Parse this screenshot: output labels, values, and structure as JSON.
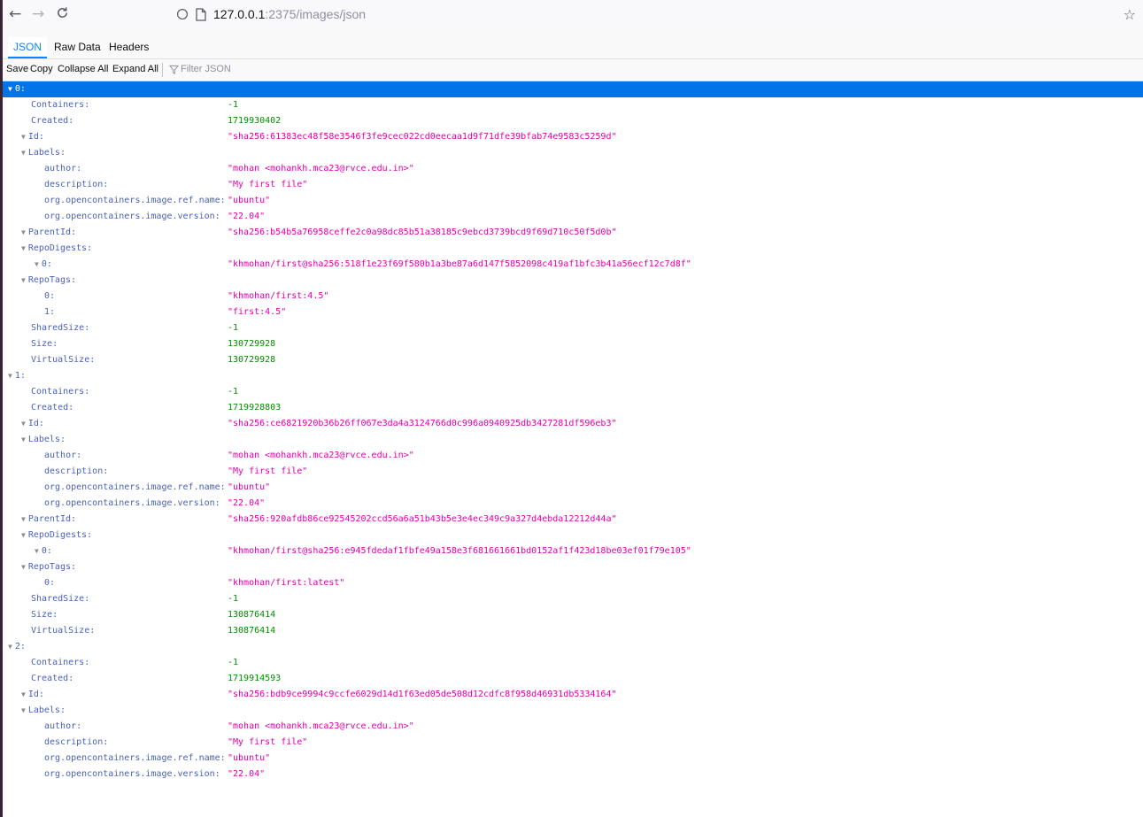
{
  "browser": {
    "back_icon": "arrow-left-icon",
    "forward_icon": "arrow-right-icon",
    "reload_icon": "reload-icon",
    "url_host": "127.0.0.1",
    "url_rest": ":2375/images/json",
    "bookmark_icon": "star-icon"
  },
  "tabs": [
    "JSON",
    "Raw Data",
    "Headers"
  ],
  "toolbar": {
    "save": "Save",
    "copy": "Copy",
    "collapse_all": "Collapse All",
    "expand_all": "Expand All",
    "filter_placeholder": "Filter JSON"
  },
  "colors": {
    "accent": "#0a84ff",
    "selected_row": "#0074e8",
    "key": "#4a62b8",
    "number": "#058b00",
    "string": "#dd00a9"
  },
  "json_rows": [
    {
      "depth": 0,
      "twisty": true,
      "key": "0:",
      "value": "",
      "type": "",
      "selected": true
    },
    {
      "depth": 1,
      "twisty": false,
      "key": "Containers:",
      "value": "-1",
      "type": "num"
    },
    {
      "depth": 1,
      "twisty": false,
      "key": "Created:",
      "value": "1719930402",
      "type": "num"
    },
    {
      "depth": 1,
      "twisty": true,
      "key": "Id:",
      "value": "\"sha256:61383ec48f58e3546f3fe9cec022cd0eecaa1d9f71dfe39bfab74e9583c5259d\"",
      "type": "str"
    },
    {
      "depth": 1,
      "twisty": true,
      "key": "Labels:",
      "value": "",
      "type": ""
    },
    {
      "depth": 2,
      "twisty": false,
      "key": "author:",
      "value": "\"mohan <mohankh.mca23@rvce.edu.in>\"",
      "type": "str"
    },
    {
      "depth": 2,
      "twisty": false,
      "key": "description:",
      "value": "\"My first file\"",
      "type": "str"
    },
    {
      "depth": 2,
      "twisty": false,
      "key": "org.opencontainers.image.ref.name:",
      "value": "\"ubuntu\"",
      "type": "str"
    },
    {
      "depth": 2,
      "twisty": false,
      "key": "org.opencontainers.image.version:",
      "value": "\"22.04\"",
      "type": "str"
    },
    {
      "depth": 1,
      "twisty": true,
      "key": "ParentId:",
      "value": "\"sha256:b54b5a76958ceffe2c0a98dc85b51a38185c9ebcd3739bcd9f69d710c50f5d0b\"",
      "type": "str"
    },
    {
      "depth": 1,
      "twisty": true,
      "key": "RepoDigests:",
      "value": "",
      "type": ""
    },
    {
      "depth": 2,
      "twisty": true,
      "key": "0:",
      "value": "\"khmohan/first@sha256:518f1e23f69f580b1a3be87a6d147f5852098c419af1bfc3b41a56ecf12c7d8f\"",
      "type": "str"
    },
    {
      "depth": 1,
      "twisty": true,
      "key": "RepoTags:",
      "value": "",
      "type": ""
    },
    {
      "depth": 2,
      "twisty": false,
      "key": "0:",
      "value": "\"khmohan/first:4.5\"",
      "type": "str"
    },
    {
      "depth": 2,
      "twisty": false,
      "key": "1:",
      "value": "\"first:4.5\"",
      "type": "str"
    },
    {
      "depth": 1,
      "twisty": false,
      "key": "SharedSize:",
      "value": "-1",
      "type": "num"
    },
    {
      "depth": 1,
      "twisty": false,
      "key": "Size:",
      "value": "130729928",
      "type": "num"
    },
    {
      "depth": 1,
      "twisty": false,
      "key": "VirtualSize:",
      "value": "130729928",
      "type": "num"
    },
    {
      "depth": 0,
      "twisty": true,
      "key": "1:",
      "value": "",
      "type": ""
    },
    {
      "depth": 1,
      "twisty": false,
      "key": "Containers:",
      "value": "-1",
      "type": "num"
    },
    {
      "depth": 1,
      "twisty": false,
      "key": "Created:",
      "value": "1719928803",
      "type": "num"
    },
    {
      "depth": 1,
      "twisty": true,
      "key": "Id:",
      "value": "\"sha256:ce6821920b36b26ff067e3da4a3124766d0c996a0940925db3427281df596eb3\"",
      "type": "str"
    },
    {
      "depth": 1,
      "twisty": true,
      "key": "Labels:",
      "value": "",
      "type": ""
    },
    {
      "depth": 2,
      "twisty": false,
      "key": "author:",
      "value": "\"mohan <mohankh.mca23@rvce.edu.in>\"",
      "type": "str"
    },
    {
      "depth": 2,
      "twisty": false,
      "key": "description:",
      "value": "\"My first file\"",
      "type": "str"
    },
    {
      "depth": 2,
      "twisty": false,
      "key": "org.opencontainers.image.ref.name:",
      "value": "\"ubuntu\"",
      "type": "str"
    },
    {
      "depth": 2,
      "twisty": false,
      "key": "org.opencontainers.image.version:",
      "value": "\"22.04\"",
      "type": "str"
    },
    {
      "depth": 1,
      "twisty": true,
      "key": "ParentId:",
      "value": "\"sha256:920afdb86ce92545202ccd56a6a51b43b5e3e4ec349c9a327d4ebda12212d44a\"",
      "type": "str"
    },
    {
      "depth": 1,
      "twisty": true,
      "key": "RepoDigests:",
      "value": "",
      "type": ""
    },
    {
      "depth": 2,
      "twisty": true,
      "key": "0:",
      "value": "\"khmohan/first@sha256:e945fdedaf1fbfe49a158e3f681661661bd0152af1f423d18be03ef01f79e105\"",
      "type": "str"
    },
    {
      "depth": 1,
      "twisty": true,
      "key": "RepoTags:",
      "value": "",
      "type": ""
    },
    {
      "depth": 2,
      "twisty": false,
      "key": "0:",
      "value": "\"khmohan/first:latest\"",
      "type": "str"
    },
    {
      "depth": 1,
      "twisty": false,
      "key": "SharedSize:",
      "value": "-1",
      "type": "num"
    },
    {
      "depth": 1,
      "twisty": false,
      "key": "Size:",
      "value": "130876414",
      "type": "num"
    },
    {
      "depth": 1,
      "twisty": false,
      "key": "VirtualSize:",
      "value": "130876414",
      "type": "num"
    },
    {
      "depth": 0,
      "twisty": true,
      "key": "2:",
      "value": "",
      "type": ""
    },
    {
      "depth": 1,
      "twisty": false,
      "key": "Containers:",
      "value": "-1",
      "type": "num"
    },
    {
      "depth": 1,
      "twisty": false,
      "key": "Created:",
      "value": "1719914593",
      "type": "num"
    },
    {
      "depth": 1,
      "twisty": true,
      "key": "Id:",
      "value": "\"sha256:bdb9ce9994c9ccfe6029d14d1f63ed05de508d12cdfc8f958d46931db5334164\"",
      "type": "str"
    },
    {
      "depth": 1,
      "twisty": true,
      "key": "Labels:",
      "value": "",
      "type": ""
    },
    {
      "depth": 2,
      "twisty": false,
      "key": "author:",
      "value": "\"mohan <mohankh.mca23@rvce.edu.in>\"",
      "type": "str"
    },
    {
      "depth": 2,
      "twisty": false,
      "key": "description:",
      "value": "\"My first file\"",
      "type": "str"
    },
    {
      "depth": 2,
      "twisty": false,
      "key": "org.opencontainers.image.ref.name:",
      "value": "\"ubuntu\"",
      "type": "str"
    },
    {
      "depth": 2,
      "twisty": false,
      "key": "org.opencontainers.image.version:",
      "value": "\"22.04\"",
      "type": "str"
    }
  ]
}
